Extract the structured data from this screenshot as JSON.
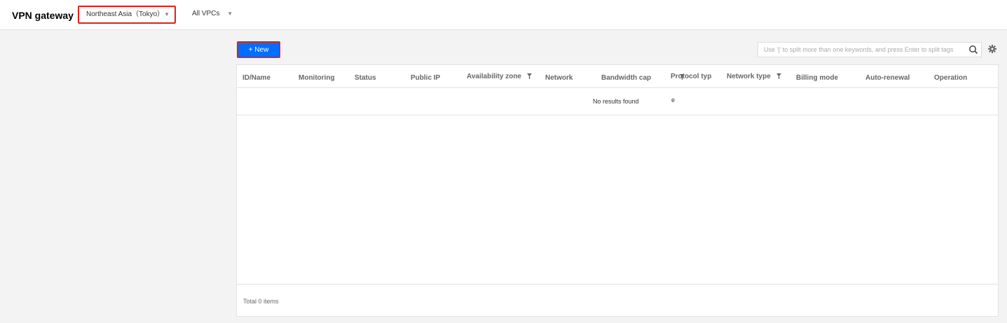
{
  "header": {
    "title": "VPN gateway",
    "region_select": {
      "value": "Northeast Asia（Tokyo）"
    },
    "vpc_select": {
      "value": "All VPCs"
    }
  },
  "toolbar": {
    "new_label": "+ New",
    "search": {
      "placeholder": "Use '|' to split more than one keywords, and press Enter to split tags"
    }
  },
  "table": {
    "columns": [
      {
        "label": "ID/Name",
        "filter": false
      },
      {
        "label": "Monitoring",
        "filter": false
      },
      {
        "label": "Status",
        "filter": false
      },
      {
        "label": "Public IP",
        "filter": false
      },
      {
        "label": "Availability zone",
        "filter": true
      },
      {
        "label": "Network",
        "filter": false
      },
      {
        "label": "Bandwidth cap",
        "filter": false
      },
      {
        "label": "Protocol typ",
        "filter": true
      },
      {
        "label": "Network type",
        "filter": true
      },
      {
        "label": "Billing mode",
        "filter": false
      },
      {
        "label": "Auto-renewal",
        "filter": false
      },
      {
        "label": "Operation",
        "filter": false
      }
    ],
    "empty_text": "No results found",
    "wrapped_text": "e",
    "footer_total": "Total 0 items"
  },
  "colors": {
    "primary": "#006eff",
    "highlight_border": "#e0211b"
  }
}
